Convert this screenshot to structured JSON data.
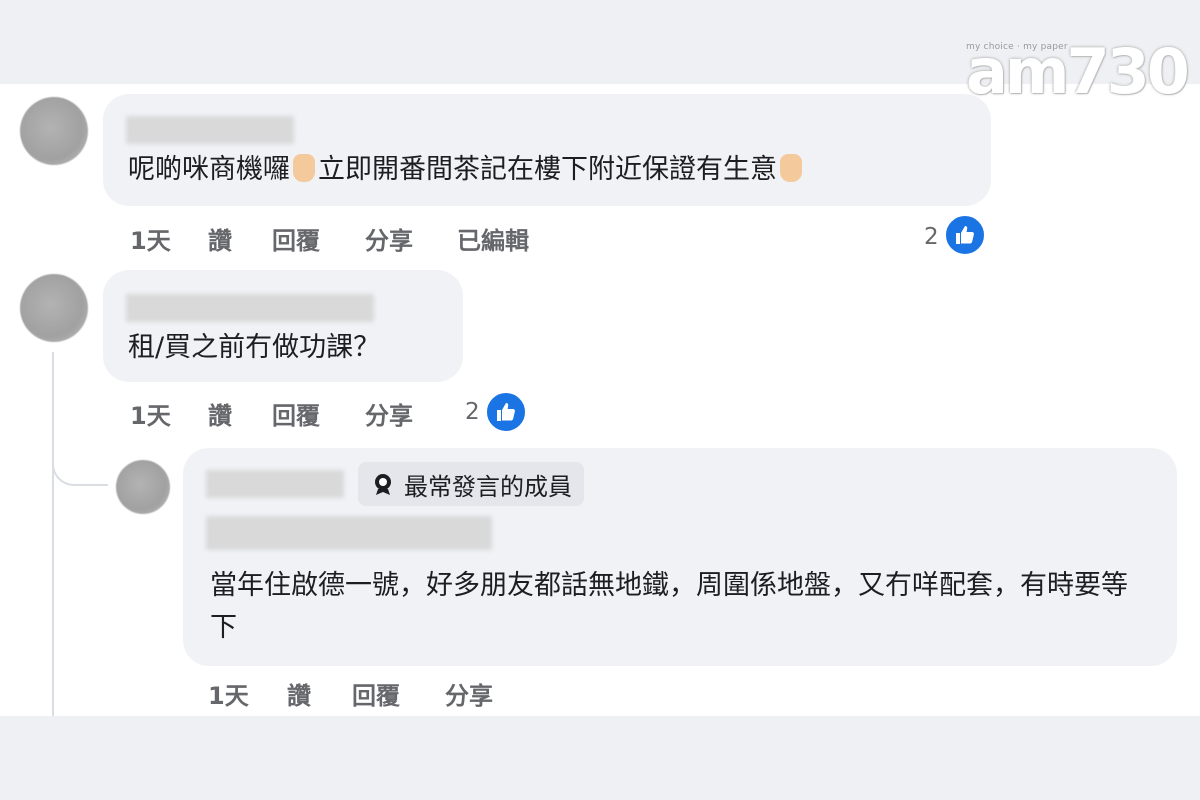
{
  "logo": {
    "tagline": "my choice · my paper",
    "wordmark": "am730"
  },
  "comments": [
    {
      "text_a": "呢啲咪商機囉",
      "text_b": "立即開番間茶記在樓下附近保證有生意",
      "time": "1天",
      "like": "讚",
      "reply": "回覆",
      "share": "分享",
      "edited": "已編輯",
      "reactions": "2"
    },
    {
      "text": "租/買之前冇做功課？",
      "time": "1天",
      "like": "讚",
      "reply": "回覆",
      "share": "分享",
      "reactions": "2"
    }
  ],
  "reply": {
    "badge": "最常發言的成員",
    "text": "當年住啟德一號，好多朋友都話無地鐵，周圍係地盤，又冇咩配套，有時要等下",
    "time": "1天",
    "like": "讚",
    "reply": "回覆",
    "share": "分享"
  },
  "colors": {
    "accent": "#1b74e4",
    "bubble": "#f0f2f5",
    "meta_text": "#65676b"
  }
}
